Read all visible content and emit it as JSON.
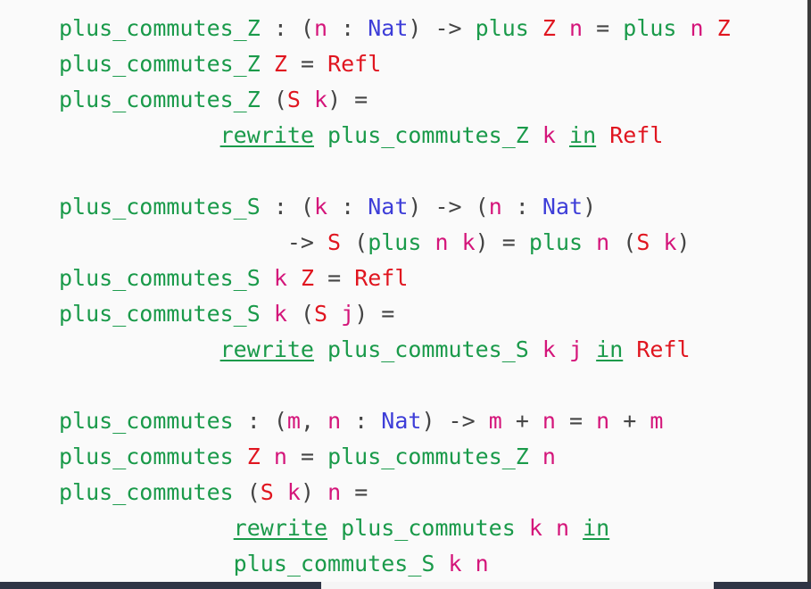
{
  "slide": {
    "lines": [
      [
        {
          "t": "fn",
          "v": "plus_commutes_Z"
        },
        {
          "t": "op",
          "v": " : ("
        },
        {
          "t": "vr",
          "v": "n"
        },
        {
          "t": "op",
          "v": " : "
        },
        {
          "t": "ty",
          "v": "Nat"
        },
        {
          "t": "op",
          "v": ") -> "
        },
        {
          "t": "fn",
          "v": "plus"
        },
        {
          "t": "op",
          "v": " "
        },
        {
          "t": "dc",
          "v": "Z"
        },
        {
          "t": "op",
          "v": " "
        },
        {
          "t": "vr",
          "v": "n"
        },
        {
          "t": "op",
          "v": " = "
        },
        {
          "t": "fn",
          "v": "plus"
        },
        {
          "t": "op",
          "v": " "
        },
        {
          "t": "vr",
          "v": "n"
        },
        {
          "t": "op",
          "v": " "
        },
        {
          "t": "dc",
          "v": "Z"
        }
      ],
      [
        {
          "t": "fn",
          "v": "plus_commutes_Z"
        },
        {
          "t": "op",
          "v": " "
        },
        {
          "t": "dc",
          "v": "Z"
        },
        {
          "t": "op",
          "v": " = "
        },
        {
          "t": "dc",
          "v": "Refl"
        }
      ],
      [
        {
          "t": "fn",
          "v": "plus_commutes_Z"
        },
        {
          "t": "op",
          "v": " ("
        },
        {
          "t": "dc",
          "v": "S"
        },
        {
          "t": "op",
          "v": " "
        },
        {
          "t": "vr",
          "v": "k"
        },
        {
          "t": "op",
          "v": ") ="
        }
      ],
      [
        {
          "t": "op",
          "v": "            "
        },
        {
          "t": "kw",
          "v": "rewrite"
        },
        {
          "t": "op",
          "v": " "
        },
        {
          "t": "fn",
          "v": "plus_commutes_Z"
        },
        {
          "t": "op",
          "v": " "
        },
        {
          "t": "vr",
          "v": "k"
        },
        {
          "t": "op",
          "v": " "
        },
        {
          "t": "kw",
          "v": "in"
        },
        {
          "t": "op",
          "v": " "
        },
        {
          "t": "dc",
          "v": "Refl"
        }
      ],
      [],
      [
        {
          "t": "fn",
          "v": "plus_commutes_S"
        },
        {
          "t": "op",
          "v": " : ("
        },
        {
          "t": "vr",
          "v": "k"
        },
        {
          "t": "op",
          "v": " : "
        },
        {
          "t": "ty",
          "v": "Nat"
        },
        {
          "t": "op",
          "v": ") -> ("
        },
        {
          "t": "vr",
          "v": "n"
        },
        {
          "t": "op",
          "v": " : "
        },
        {
          "t": "ty",
          "v": "Nat"
        },
        {
          "t": "op",
          "v": ")"
        }
      ],
      [
        {
          "t": "op",
          "v": "                 -> "
        },
        {
          "t": "dc",
          "v": "S"
        },
        {
          "t": "op",
          "v": " ("
        },
        {
          "t": "fn",
          "v": "plus"
        },
        {
          "t": "op",
          "v": " "
        },
        {
          "t": "vr",
          "v": "n"
        },
        {
          "t": "op",
          "v": " "
        },
        {
          "t": "vr",
          "v": "k"
        },
        {
          "t": "op",
          "v": ") = "
        },
        {
          "t": "fn",
          "v": "plus"
        },
        {
          "t": "op",
          "v": " "
        },
        {
          "t": "vr",
          "v": "n"
        },
        {
          "t": "op",
          "v": " ("
        },
        {
          "t": "dc",
          "v": "S"
        },
        {
          "t": "op",
          "v": " "
        },
        {
          "t": "vr",
          "v": "k"
        },
        {
          "t": "op",
          "v": ")"
        }
      ],
      [
        {
          "t": "fn",
          "v": "plus_commutes_S"
        },
        {
          "t": "op",
          "v": " "
        },
        {
          "t": "vr",
          "v": "k"
        },
        {
          "t": "op",
          "v": " "
        },
        {
          "t": "dc",
          "v": "Z"
        },
        {
          "t": "op",
          "v": " = "
        },
        {
          "t": "dc",
          "v": "Refl"
        }
      ],
      [
        {
          "t": "fn",
          "v": "plus_commutes_S"
        },
        {
          "t": "op",
          "v": " "
        },
        {
          "t": "vr",
          "v": "k"
        },
        {
          "t": "op",
          "v": " ("
        },
        {
          "t": "dc",
          "v": "S"
        },
        {
          "t": "op",
          "v": " "
        },
        {
          "t": "vr",
          "v": "j"
        },
        {
          "t": "op",
          "v": ") ="
        }
      ],
      [
        {
          "t": "op",
          "v": "            "
        },
        {
          "t": "kw",
          "v": "rewrite"
        },
        {
          "t": "op",
          "v": " "
        },
        {
          "t": "fn",
          "v": "plus_commutes_S"
        },
        {
          "t": "op",
          "v": " "
        },
        {
          "t": "vr",
          "v": "k"
        },
        {
          "t": "op",
          "v": " "
        },
        {
          "t": "vr",
          "v": "j"
        },
        {
          "t": "op",
          "v": " "
        },
        {
          "t": "kw",
          "v": "in"
        },
        {
          "t": "op",
          "v": " "
        },
        {
          "t": "dc",
          "v": "Refl"
        }
      ],
      [],
      [
        {
          "t": "fn",
          "v": "plus_commutes"
        },
        {
          "t": "op",
          "v": " : ("
        },
        {
          "t": "vr",
          "v": "m"
        },
        {
          "t": "op",
          "v": ", "
        },
        {
          "t": "vr",
          "v": "n"
        },
        {
          "t": "op",
          "v": " : "
        },
        {
          "t": "ty",
          "v": "Nat"
        },
        {
          "t": "op",
          "v": ") -> "
        },
        {
          "t": "vr",
          "v": "m"
        },
        {
          "t": "op",
          "v": " + "
        },
        {
          "t": "vr",
          "v": "n"
        },
        {
          "t": "op",
          "v": " = "
        },
        {
          "t": "vr",
          "v": "n"
        },
        {
          "t": "op",
          "v": " + "
        },
        {
          "t": "vr",
          "v": "m"
        }
      ],
      [
        {
          "t": "fn",
          "v": "plus_commutes"
        },
        {
          "t": "op",
          "v": " "
        },
        {
          "t": "dc",
          "v": "Z"
        },
        {
          "t": "op",
          "v": " "
        },
        {
          "t": "vr",
          "v": "n"
        },
        {
          "t": "op",
          "v": " = "
        },
        {
          "t": "fn",
          "v": "plus_commutes_Z"
        },
        {
          "t": "op",
          "v": " "
        },
        {
          "t": "vr",
          "v": "n"
        }
      ],
      [
        {
          "t": "fn",
          "v": "plus_commutes"
        },
        {
          "t": "op",
          "v": " ("
        },
        {
          "t": "dc",
          "v": "S"
        },
        {
          "t": "op",
          "v": " "
        },
        {
          "t": "vr",
          "v": "k"
        },
        {
          "t": "op",
          "v": ") "
        },
        {
          "t": "vr",
          "v": "n"
        },
        {
          "t": "op",
          "v": " ="
        }
      ],
      [
        {
          "t": "op",
          "v": "             "
        },
        {
          "t": "kw",
          "v": "rewrite"
        },
        {
          "t": "op",
          "v": " "
        },
        {
          "t": "fn",
          "v": "plus_commutes"
        },
        {
          "t": "op",
          "v": " "
        },
        {
          "t": "vr",
          "v": "k"
        },
        {
          "t": "op",
          "v": " "
        },
        {
          "t": "vr",
          "v": "n"
        },
        {
          "t": "op",
          "v": " "
        },
        {
          "t": "kw",
          "v": "in"
        }
      ],
      [
        {
          "t": "op",
          "v": "             "
        },
        {
          "t": "fn",
          "v": "plus_commutes_S"
        },
        {
          "t": "op",
          "v": " "
        },
        {
          "t": "vr",
          "v": "k"
        },
        {
          "t": "op",
          "v": " "
        },
        {
          "t": "vr",
          "v": "n"
        }
      ]
    ]
  },
  "colors": {
    "function": "#1a9a4a",
    "type": "#3d3dd8",
    "variable": "#d4157a",
    "constructor": "#e0151f",
    "keyword": "#1a9a4a",
    "footer": "#2f3545"
  }
}
